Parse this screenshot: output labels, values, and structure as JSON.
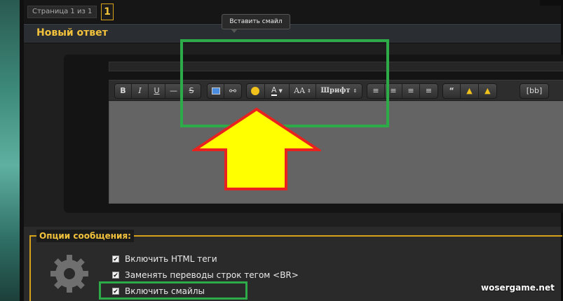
{
  "pagination": {
    "label": "Страница 1 из 1",
    "current": "1"
  },
  "header": {
    "title": "Новый ответ"
  },
  "tooltip": {
    "text": "Вставить смайл"
  },
  "toolbar": {
    "bold": "B",
    "italic": "I",
    "underline": "U",
    "hr": "—",
    "strike": "S",
    "font_label": "Шрифт",
    "size_label": "AA",
    "bbcode": "[bb]"
  },
  "options": {
    "title": "Опции сообщения:",
    "items": [
      {
        "label": "Включить HTML теги",
        "checked": true
      },
      {
        "label": "Заменять переводы строк тегом <BR>",
        "checked": true
      },
      {
        "label": "Включить смайлы",
        "checked": true
      }
    ]
  },
  "watermark": "wosergame.net",
  "colors": {
    "accent": "#f3c23c",
    "highlight_green": "#2cab48",
    "arrow_fill": "#ffff00",
    "arrow_stroke": "#e8231f"
  }
}
